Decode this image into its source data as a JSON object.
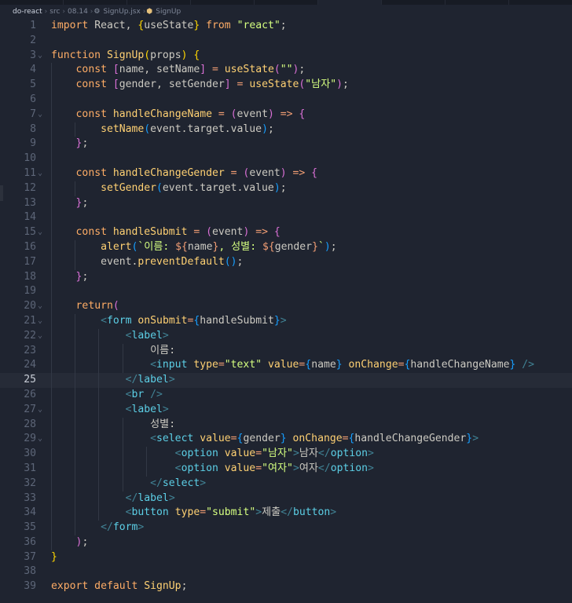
{
  "breadcrumb": {
    "root": "do-react",
    "items": [
      "src",
      "08.14",
      "SignUp.jsx",
      "SignUp"
    ],
    "separator": "›"
  },
  "editor": {
    "current_line": 25,
    "lines": [
      [
        {
          "c": "k",
          "t": "import"
        },
        {
          "c": "p",
          "t": " React, "
        },
        {
          "c": "br1",
          "t": "{"
        },
        {
          "c": "p",
          "t": "useState"
        },
        {
          "c": "br1",
          "t": "}"
        },
        {
          "c": "k",
          "t": " from "
        },
        {
          "c": "s",
          "t": "\"react\""
        },
        {
          "c": "p",
          "t": ";"
        }
      ],
      [],
      [
        {
          "c": "k",
          "t": "function "
        },
        {
          "c": "f",
          "t": "SignUp"
        },
        {
          "c": "br1",
          "t": "("
        },
        {
          "c": "p",
          "t": "props"
        },
        {
          "c": "br1",
          "t": ")"
        },
        {
          "c": "p",
          "t": " "
        },
        {
          "c": "br1",
          "t": "{"
        }
      ],
      [
        {
          "c": "p",
          "t": "    "
        },
        {
          "c": "k",
          "t": "const "
        },
        {
          "c": "br2",
          "t": "["
        },
        {
          "c": "p",
          "t": "name, setName"
        },
        {
          "c": "br2",
          "t": "]"
        },
        {
          "c": "o",
          "t": " = "
        },
        {
          "c": "f",
          "t": "useState"
        },
        {
          "c": "br2",
          "t": "("
        },
        {
          "c": "s",
          "t": "\"\""
        },
        {
          "c": "br2",
          "t": ")"
        },
        {
          "c": "p",
          "t": ";"
        }
      ],
      [
        {
          "c": "p",
          "t": "    "
        },
        {
          "c": "k",
          "t": "const "
        },
        {
          "c": "br2",
          "t": "["
        },
        {
          "c": "p",
          "t": "gender, setGender"
        },
        {
          "c": "br2",
          "t": "]"
        },
        {
          "c": "o",
          "t": " = "
        },
        {
          "c": "f",
          "t": "useState"
        },
        {
          "c": "br2",
          "t": "("
        },
        {
          "c": "s",
          "t": "\"남자\""
        },
        {
          "c": "br2",
          "t": ")"
        },
        {
          "c": "p",
          "t": ";"
        }
      ],
      [],
      [
        {
          "c": "p",
          "t": "    "
        },
        {
          "c": "k",
          "t": "const "
        },
        {
          "c": "f",
          "t": "handleChangeName"
        },
        {
          "c": "o",
          "t": " = "
        },
        {
          "c": "br2",
          "t": "("
        },
        {
          "c": "p",
          "t": "event"
        },
        {
          "c": "br2",
          "t": ")"
        },
        {
          "c": "o",
          "t": " => "
        },
        {
          "c": "br2",
          "t": "{"
        }
      ],
      [
        {
          "c": "p",
          "t": "        "
        },
        {
          "c": "f",
          "t": "setName"
        },
        {
          "c": "br3",
          "t": "("
        },
        {
          "c": "p",
          "t": "event.target.value"
        },
        {
          "c": "br3",
          "t": ")"
        },
        {
          "c": "p",
          "t": ";"
        }
      ],
      [
        {
          "c": "p",
          "t": "    "
        },
        {
          "c": "br2",
          "t": "}"
        },
        {
          "c": "p",
          "t": ";"
        }
      ],
      [],
      [
        {
          "c": "p",
          "t": "    "
        },
        {
          "c": "k",
          "t": "const "
        },
        {
          "c": "f",
          "t": "handleChangeGender"
        },
        {
          "c": "o",
          "t": " = "
        },
        {
          "c": "br2",
          "t": "("
        },
        {
          "c": "p",
          "t": "event"
        },
        {
          "c": "br2",
          "t": ")"
        },
        {
          "c": "o",
          "t": " => "
        },
        {
          "c": "br2",
          "t": "{"
        }
      ],
      [
        {
          "c": "p",
          "t": "        "
        },
        {
          "c": "f",
          "t": "setGender"
        },
        {
          "c": "br3",
          "t": "("
        },
        {
          "c": "p",
          "t": "event.target.value"
        },
        {
          "c": "br3",
          "t": ")"
        },
        {
          "c": "p",
          "t": ";"
        }
      ],
      [
        {
          "c": "p",
          "t": "    "
        },
        {
          "c": "br2",
          "t": "}"
        },
        {
          "c": "p",
          "t": ";"
        }
      ],
      [],
      [
        {
          "c": "p",
          "t": "    "
        },
        {
          "c": "k",
          "t": "const "
        },
        {
          "c": "f",
          "t": "handleSubmit"
        },
        {
          "c": "o",
          "t": " = "
        },
        {
          "c": "br2",
          "t": "("
        },
        {
          "c": "p",
          "t": "event"
        },
        {
          "c": "br2",
          "t": ")"
        },
        {
          "c": "o",
          "t": " => "
        },
        {
          "c": "br2",
          "t": "{"
        }
      ],
      [
        {
          "c": "p",
          "t": "        "
        },
        {
          "c": "f",
          "t": "alert"
        },
        {
          "c": "br3",
          "t": "("
        },
        {
          "c": "s",
          "t": "`이름: "
        },
        {
          "c": "o",
          "t": "${"
        },
        {
          "c": "p",
          "t": "name"
        },
        {
          "c": "o",
          "t": "}"
        },
        {
          "c": "s",
          "t": ", 성별: "
        },
        {
          "c": "o",
          "t": "${"
        },
        {
          "c": "p",
          "t": "gender"
        },
        {
          "c": "o",
          "t": "}"
        },
        {
          "c": "s",
          "t": "`"
        },
        {
          "c": "br3",
          "t": ")"
        },
        {
          "c": "p",
          "t": ";"
        }
      ],
      [
        {
          "c": "p",
          "t": "        event."
        },
        {
          "c": "f",
          "t": "preventDefault"
        },
        {
          "c": "br3",
          "t": "()"
        },
        {
          "c": "p",
          "t": ";"
        }
      ],
      [
        {
          "c": "p",
          "t": "    "
        },
        {
          "c": "br2",
          "t": "}"
        },
        {
          "c": "p",
          "t": ";"
        }
      ],
      [],
      [
        {
          "c": "p",
          "t": "    "
        },
        {
          "c": "k",
          "t": "return"
        },
        {
          "c": "br2",
          "t": "("
        }
      ],
      [
        {
          "c": "p",
          "t": "        "
        },
        {
          "c": "tagc",
          "t": "<"
        },
        {
          "c": "t",
          "t": "form"
        },
        {
          "c": "p",
          "t": " "
        },
        {
          "c": "a",
          "t": "onSubmit"
        },
        {
          "c": "o",
          "t": "="
        },
        {
          "c": "br3",
          "t": "{"
        },
        {
          "c": "p",
          "t": "handleSubmit"
        },
        {
          "c": "br3",
          "t": "}"
        },
        {
          "c": "tagc",
          "t": ">"
        }
      ],
      [
        {
          "c": "p",
          "t": "            "
        },
        {
          "c": "tagc",
          "t": "<"
        },
        {
          "c": "t",
          "t": "label"
        },
        {
          "c": "tagc",
          "t": ">"
        }
      ],
      [
        {
          "c": "p",
          "t": "                이름:"
        }
      ],
      [
        {
          "c": "p",
          "t": "                "
        },
        {
          "c": "tagc",
          "t": "<"
        },
        {
          "c": "t",
          "t": "input"
        },
        {
          "c": "p",
          "t": " "
        },
        {
          "c": "a",
          "t": "type"
        },
        {
          "c": "o",
          "t": "="
        },
        {
          "c": "s",
          "t": "\"text\""
        },
        {
          "c": "p",
          "t": " "
        },
        {
          "c": "a",
          "t": "value"
        },
        {
          "c": "o",
          "t": "="
        },
        {
          "c": "br3",
          "t": "{"
        },
        {
          "c": "p",
          "t": "name"
        },
        {
          "c": "br3",
          "t": "}"
        },
        {
          "c": "p",
          "t": " "
        },
        {
          "c": "a",
          "t": "onChange"
        },
        {
          "c": "o",
          "t": "="
        },
        {
          "c": "br3",
          "t": "{"
        },
        {
          "c": "p",
          "t": "handleChangeName"
        },
        {
          "c": "br3",
          "t": "}"
        },
        {
          "c": "p",
          "t": " "
        },
        {
          "c": "tagc",
          "t": "/>"
        }
      ],
      [
        {
          "c": "p",
          "t": "            "
        },
        {
          "c": "tagc",
          "t": "</"
        },
        {
          "c": "t",
          "t": "label"
        },
        {
          "c": "tagc",
          "t": ">"
        }
      ],
      [
        {
          "c": "p",
          "t": "            "
        },
        {
          "c": "tagc",
          "t": "<"
        },
        {
          "c": "t",
          "t": "br"
        },
        {
          "c": "p",
          "t": " "
        },
        {
          "c": "tagc",
          "t": "/>"
        }
      ],
      [
        {
          "c": "p",
          "t": "            "
        },
        {
          "c": "tagc",
          "t": "<"
        },
        {
          "c": "t",
          "t": "label"
        },
        {
          "c": "tagc",
          "t": ">"
        }
      ],
      [
        {
          "c": "p",
          "t": "                성별:"
        }
      ],
      [
        {
          "c": "p",
          "t": "                "
        },
        {
          "c": "tagc",
          "t": "<"
        },
        {
          "c": "t",
          "t": "select"
        },
        {
          "c": "p",
          "t": " "
        },
        {
          "c": "a",
          "t": "value"
        },
        {
          "c": "o",
          "t": "="
        },
        {
          "c": "br3",
          "t": "{"
        },
        {
          "c": "p",
          "t": "gender"
        },
        {
          "c": "br3",
          "t": "}"
        },
        {
          "c": "p",
          "t": " "
        },
        {
          "c": "a",
          "t": "onChange"
        },
        {
          "c": "o",
          "t": "="
        },
        {
          "c": "br3",
          "t": "{"
        },
        {
          "c": "p",
          "t": "handleChangeGender"
        },
        {
          "c": "br3",
          "t": "}"
        },
        {
          "c": "tagc",
          "t": ">"
        }
      ],
      [
        {
          "c": "p",
          "t": "                    "
        },
        {
          "c": "tagc",
          "t": "<"
        },
        {
          "c": "t",
          "t": "option"
        },
        {
          "c": "p",
          "t": " "
        },
        {
          "c": "a",
          "t": "value"
        },
        {
          "c": "o",
          "t": "="
        },
        {
          "c": "s",
          "t": "\"남자\""
        },
        {
          "c": "tagc",
          "t": ">"
        },
        {
          "c": "p",
          "t": "남자"
        },
        {
          "c": "tagc",
          "t": "</"
        },
        {
          "c": "t",
          "t": "option"
        },
        {
          "c": "tagc",
          "t": ">"
        }
      ],
      [
        {
          "c": "p",
          "t": "                    "
        },
        {
          "c": "tagc",
          "t": "<"
        },
        {
          "c": "t",
          "t": "option"
        },
        {
          "c": "p",
          "t": " "
        },
        {
          "c": "a",
          "t": "value"
        },
        {
          "c": "o",
          "t": "="
        },
        {
          "c": "s",
          "t": "\"여자\""
        },
        {
          "c": "tagc",
          "t": ">"
        },
        {
          "c": "p",
          "t": "여자"
        },
        {
          "c": "tagc",
          "t": "</"
        },
        {
          "c": "t",
          "t": "option"
        },
        {
          "c": "tagc",
          "t": ">"
        }
      ],
      [
        {
          "c": "p",
          "t": "                "
        },
        {
          "c": "tagc",
          "t": "</"
        },
        {
          "c": "t",
          "t": "select"
        },
        {
          "c": "tagc",
          "t": ">"
        }
      ],
      [
        {
          "c": "p",
          "t": "            "
        },
        {
          "c": "tagc",
          "t": "</"
        },
        {
          "c": "t",
          "t": "label"
        },
        {
          "c": "tagc",
          "t": ">"
        }
      ],
      [
        {
          "c": "p",
          "t": "            "
        },
        {
          "c": "tagc",
          "t": "<"
        },
        {
          "c": "t",
          "t": "button"
        },
        {
          "c": "p",
          "t": " "
        },
        {
          "c": "a",
          "t": "type"
        },
        {
          "c": "o",
          "t": "="
        },
        {
          "c": "s",
          "t": "\"submit\""
        },
        {
          "c": "tagc",
          "t": ">"
        },
        {
          "c": "p",
          "t": "제출"
        },
        {
          "c": "tagc",
          "t": "</"
        },
        {
          "c": "t",
          "t": "button"
        },
        {
          "c": "tagc",
          "t": ">"
        }
      ],
      [
        {
          "c": "p",
          "t": "        "
        },
        {
          "c": "tagc",
          "t": "</"
        },
        {
          "c": "t",
          "t": "form"
        },
        {
          "c": "tagc",
          "t": ">"
        }
      ],
      [
        {
          "c": "p",
          "t": "    "
        },
        {
          "c": "br2",
          "t": ")"
        },
        {
          "c": "p",
          "t": ";"
        }
      ],
      [
        {
          "c": "br1",
          "t": "}"
        }
      ],
      [],
      [
        {
          "c": "k",
          "t": "export default "
        },
        {
          "c": "f",
          "t": "SignUp"
        },
        {
          "c": "p",
          "t": ";"
        }
      ]
    ]
  },
  "theme": {
    "background": "#1f2430",
    "keyword": "#ffad66",
    "function": "#ffd173",
    "string": "#d5ff80",
    "tag": "#5ccfe6"
  }
}
